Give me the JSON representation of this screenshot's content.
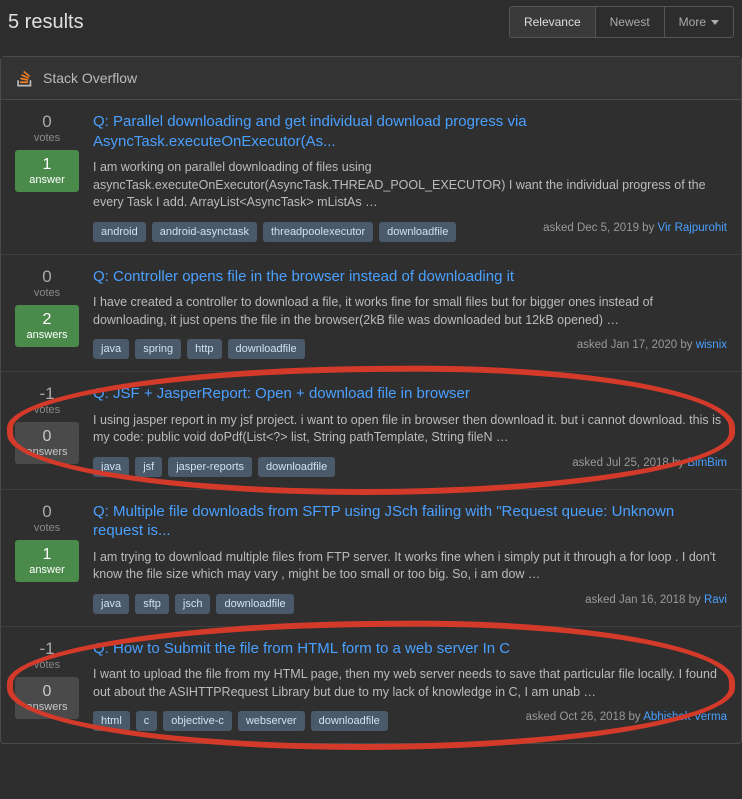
{
  "header": {
    "count_label": "5 results",
    "tabs": [
      "Relevance",
      "Newest",
      "More"
    ]
  },
  "panel_title": "Stack Overflow",
  "results": [
    {
      "votes": "0",
      "answers": "1",
      "has_answer": true,
      "title": "Parallel downloading and get individual download progress via AsyncTask.executeOnExecutor(As...",
      "excerpt": "I am working on parallel downloading of files using asyncTask.executeOnExecutor(AsyncTask.THREAD_POOL_EXECUTOR) I want the individual progress of the every Task I add. ArrayList<AsyncTask> mListAs …",
      "tags": [
        "android",
        "android-asynctask",
        "threadpoolexecutor",
        "downloadfile"
      ],
      "asked": "asked Dec 5, 2019 by",
      "author": "Vir Rajpurohit",
      "circle": false
    },
    {
      "votes": "0",
      "answers": "2",
      "has_answer": true,
      "title": "Controller opens file in the browser instead of downloading it",
      "excerpt": "I have created a controller to download a file, it works fine for small files but for bigger ones instead of downloading, it just opens the file in the browser(2kB file was downloaded but 12kB opened) …",
      "tags": [
        "java",
        "spring",
        "http",
        "downloadfile"
      ],
      "asked": "asked Jan 17, 2020 by",
      "author": "wisnix",
      "circle": false
    },
    {
      "votes": "-1",
      "answers": "0",
      "has_answer": false,
      "title": "JSF + JasperReport: Open + download file in browser",
      "excerpt": "I using jasper report in my jsf project. i want to open file in browser then download it. but i cannot download. this is my code: public void doPdf(List<?> list, String pathTemplate, String fileN …",
      "tags": [
        "java",
        "jsf",
        "jasper-reports",
        "downloadfile"
      ],
      "asked": "asked Jul 25, 2018 by",
      "author": "BimBim",
      "circle": true
    },
    {
      "votes": "0",
      "answers": "1",
      "has_answer": true,
      "title": "Multiple file downloads from SFTP using JSch failing with \"Request queue: Unknown request is...",
      "excerpt": "I am trying to download multiple files from FTP server. It works fine when i simply put it through a for loop . I don't know the file size which may vary , might be too small or too big. So, i am dow …",
      "tags": [
        "java",
        "sftp",
        "jsch",
        "downloadfile"
      ],
      "asked": "asked Jan 16, 2018 by",
      "author": "Ravi",
      "circle": false
    },
    {
      "votes": "-1",
      "answers": "0",
      "has_answer": false,
      "title": "How to Submit the file from HTML form to a web server In C",
      "excerpt": "I want to upload the file from my HTML page, then my web server needs to save that particular file locally. I found out about the ASIHTTPRequest Library but due to my lack of knowledge in C, I am unab …",
      "tags": [
        "html",
        "c",
        "objective-c",
        "webserver",
        "downloadfile"
      ],
      "asked": "asked Oct 26, 2018 by",
      "author": "Abhishek Verma",
      "circle": true
    }
  ],
  "labels": {
    "votes": "votes",
    "answer": "answer",
    "answers": "answers",
    "q_prefix": "Q:"
  }
}
